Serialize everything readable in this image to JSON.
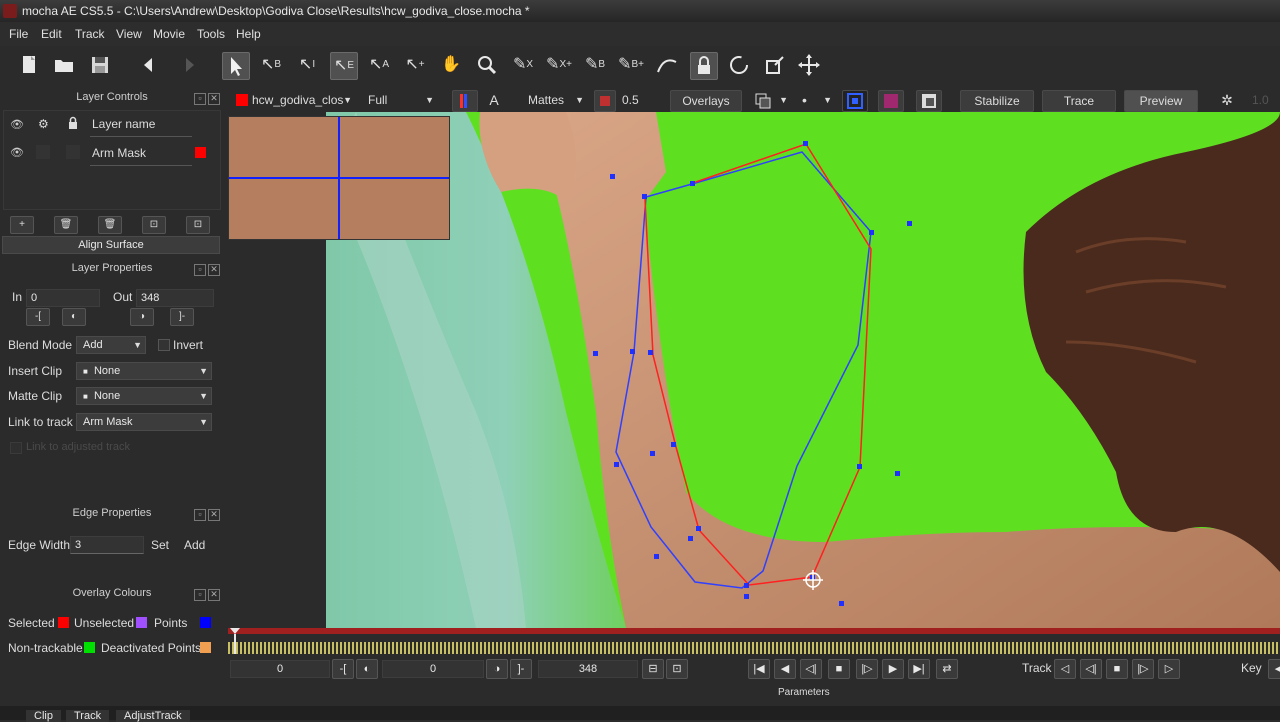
{
  "window": {
    "title": "mocha AE CS5.5 - C:\\Users\\Andrew\\Desktop\\Godiva Close\\Results\\hcw_godiva_close.mocha *"
  },
  "menu": [
    "File",
    "Edit",
    "Track",
    "View",
    "Movie",
    "Tools",
    "Help"
  ],
  "viewbar": {
    "clip": "hcw_godiva_clos",
    "quality": "Full",
    "channel_a": "A",
    "mattes": "Mattes",
    "opacity": "0.5",
    "overlays": "Overlays",
    "stabilize": "Stabilize",
    "trace": "Trace",
    "preview": "Preview",
    "value": "1.0"
  },
  "layer_controls": {
    "title": "Layer Controls",
    "header": "Layer name",
    "layers": [
      {
        "name": "Arm Mask",
        "color": "#ff0000"
      }
    ],
    "align_surface": "Align Surface"
  },
  "layer_properties": {
    "title": "Layer Properties",
    "in_label": "In",
    "in_value": "0",
    "out_label": "Out",
    "out_value": "348",
    "blend_label": "Blend Mode",
    "blend_value": "Add",
    "invert_label": "Invert",
    "insert_label": "Insert Clip",
    "insert_value": "None",
    "matte_label": "Matte Clip",
    "matte_value": "None",
    "link_label": "Link to track",
    "link_value": "Arm Mask",
    "link_adjusted": "Link to adjusted track"
  },
  "edge_properties": {
    "title": "Edge Properties",
    "width_label": "Edge Width",
    "width_value": "3",
    "set": "Set",
    "add": "Add"
  },
  "overlay_colours": {
    "title": "Overlay Colours",
    "selected": "Selected",
    "selected_color": "#ff0000",
    "unselected": "Unselected",
    "unselected_color": "#a050ff",
    "points": "Points",
    "points_color": "#0000ff",
    "nontrackable": "Non-trackable",
    "nontrackable_color": "#00e000",
    "deactivated": "Deactivated Points",
    "deactivated_color": "#f0a050"
  },
  "transport": {
    "frame": "0",
    "in": "0",
    "out": "348",
    "track": "Track",
    "key": "Key",
    "parameters": "Parameters"
  },
  "bottom_tabs": [
    "Clip",
    "Track",
    "AdjustTrack"
  ]
}
